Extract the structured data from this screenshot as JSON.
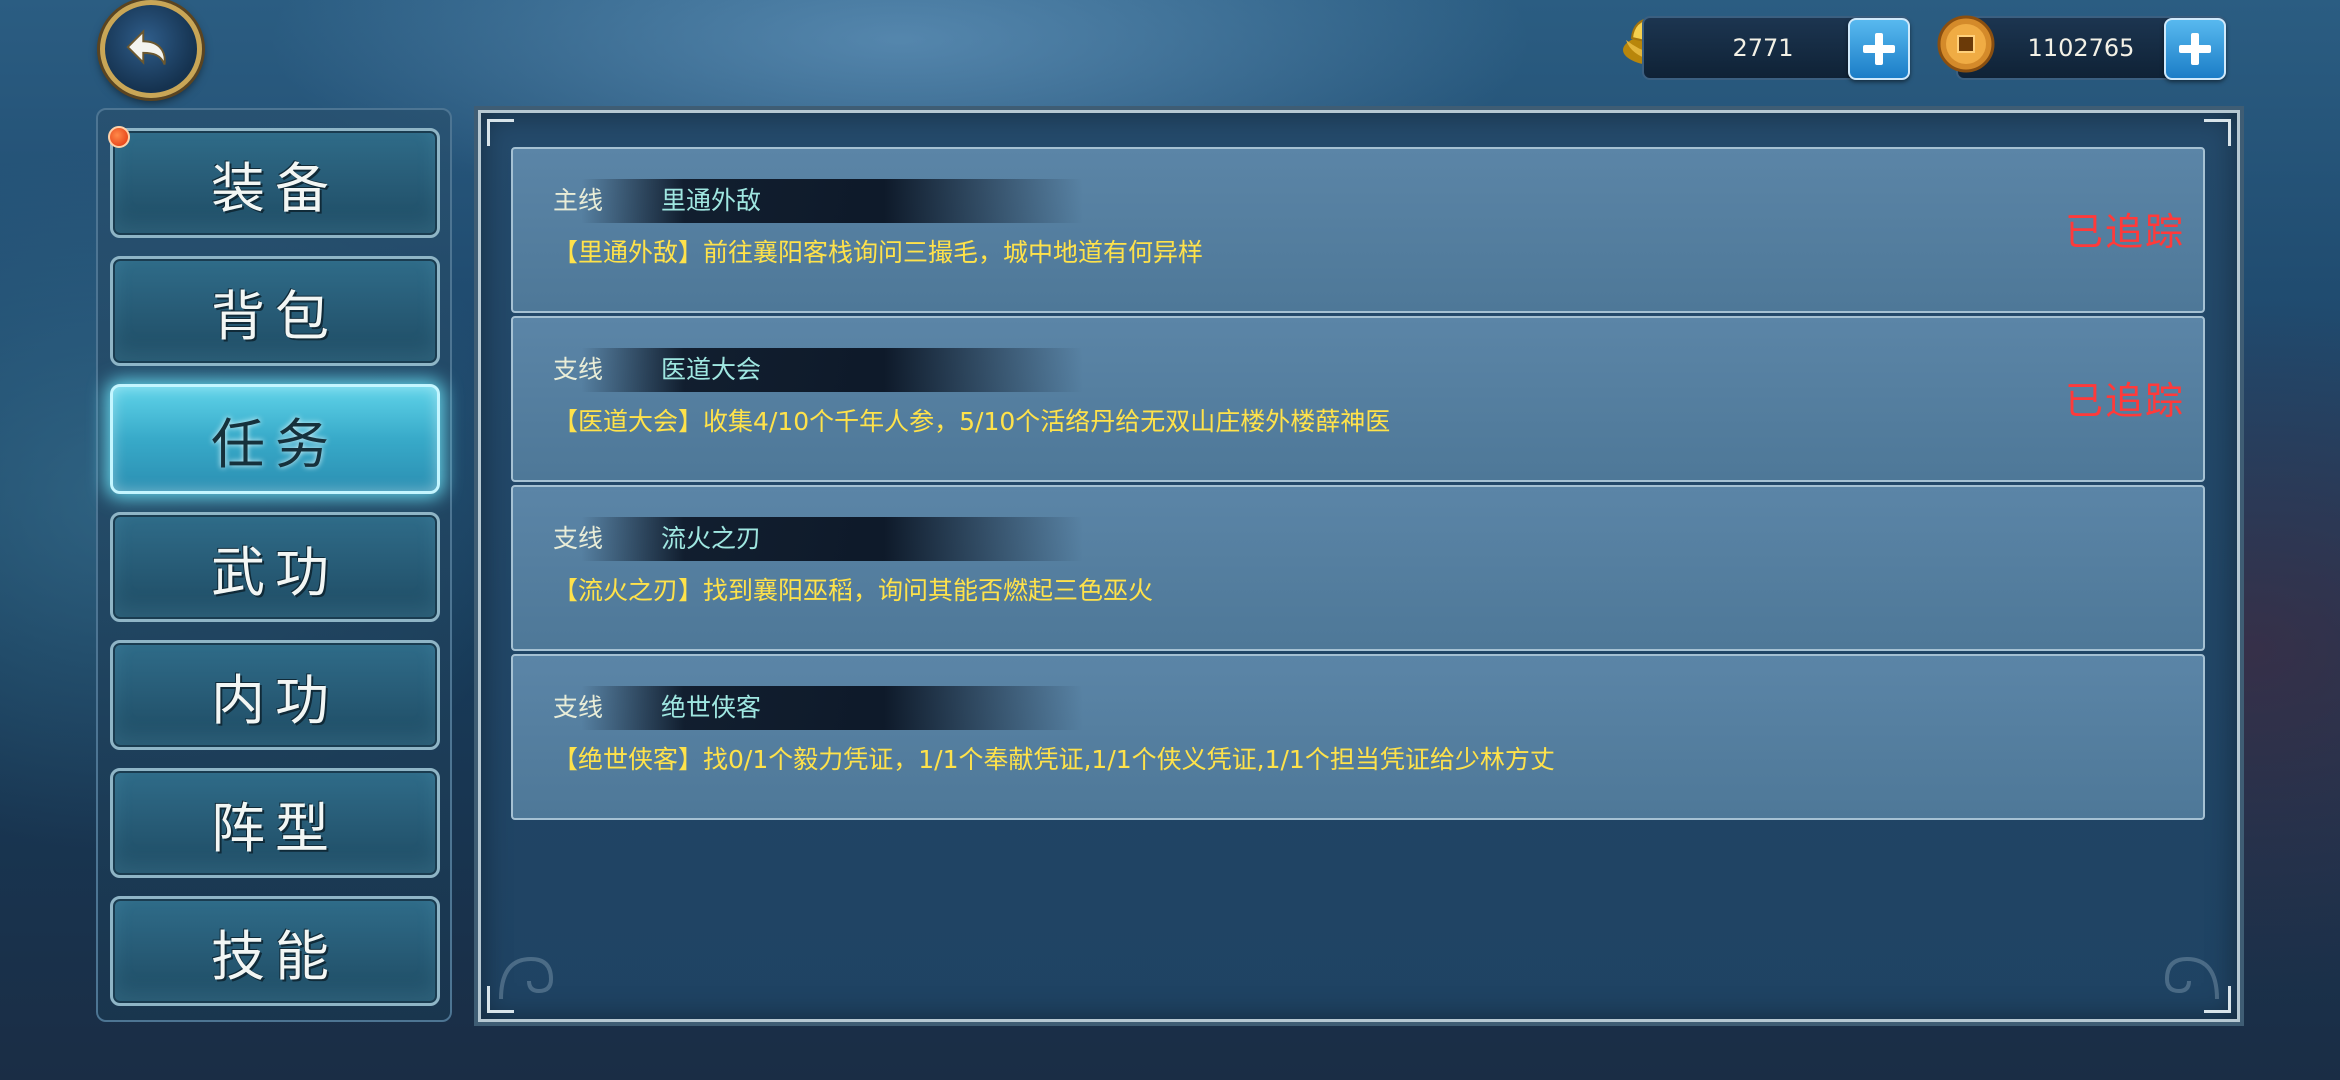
{
  "header": {
    "back_icon": "back-arrow-icon",
    "currencies": [
      {
        "icon": "gold-ingot-icon",
        "value": "2771"
      },
      {
        "icon": "copper-coin-icon",
        "value": "1102765"
      }
    ]
  },
  "sidebar": {
    "tabs": [
      {
        "label": "装备",
        "active": false
      },
      {
        "label": "背包",
        "active": false
      },
      {
        "label": "任务",
        "active": true
      },
      {
        "label": "武功",
        "active": false
      },
      {
        "label": "内功",
        "active": false
      },
      {
        "label": "阵型",
        "active": false
      },
      {
        "label": "技能",
        "active": false
      }
    ]
  },
  "quests": [
    {
      "type": "主线",
      "name": "里通外敌",
      "desc": "【里通外敌】前往襄阳客栈询问三撮毛，城中地道有何异样",
      "tracked": "已追踪"
    },
    {
      "type": "支线",
      "name": "医道大会",
      "desc": "【医道大会】收集4/10个千年人参，5/10个活络丹给无双山庄楼外楼薛神医",
      "tracked": "已追踪"
    },
    {
      "type": "支线",
      "name": "流火之刃",
      "desc": "【流火之刃】找到襄阳巫稻，询问其能否燃起三色巫火",
      "tracked": ""
    },
    {
      "type": "支线",
      "name": "绝世侠客",
      "desc": "【绝世侠客】找0/1个毅力凭证，1/1个奉献凭证,1/1个侠义凭证,1/1个担当凭证给少林方丈",
      "tracked": ""
    }
  ],
  "colors": {
    "tracked": "#ff3a3a",
    "desc": "#ffe24a",
    "name": "#9fe7e1",
    "active_tab": "#5fd3e9"
  }
}
